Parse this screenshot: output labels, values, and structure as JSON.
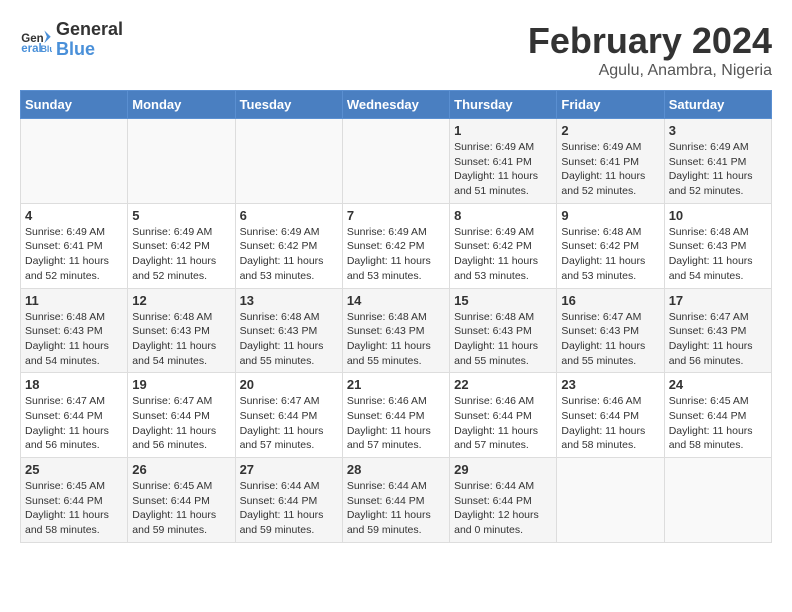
{
  "logo": {
    "text_general": "General",
    "text_blue": "Blue"
  },
  "title": "February 2024",
  "subtitle": "Agulu, Anambra, Nigeria",
  "days_of_week": [
    "Sunday",
    "Monday",
    "Tuesday",
    "Wednesday",
    "Thursday",
    "Friday",
    "Saturday"
  ],
  "weeks": [
    [
      {
        "day": "",
        "info": ""
      },
      {
        "day": "",
        "info": ""
      },
      {
        "day": "",
        "info": ""
      },
      {
        "day": "",
        "info": ""
      },
      {
        "day": "1",
        "info": "Sunrise: 6:49 AM\nSunset: 6:41 PM\nDaylight: 11 hours\nand 51 minutes."
      },
      {
        "day": "2",
        "info": "Sunrise: 6:49 AM\nSunset: 6:41 PM\nDaylight: 11 hours\nand 52 minutes."
      },
      {
        "day": "3",
        "info": "Sunrise: 6:49 AM\nSunset: 6:41 PM\nDaylight: 11 hours\nand 52 minutes."
      }
    ],
    [
      {
        "day": "4",
        "info": "Sunrise: 6:49 AM\nSunset: 6:41 PM\nDaylight: 11 hours\nand 52 minutes."
      },
      {
        "day": "5",
        "info": "Sunrise: 6:49 AM\nSunset: 6:42 PM\nDaylight: 11 hours\nand 52 minutes."
      },
      {
        "day": "6",
        "info": "Sunrise: 6:49 AM\nSunset: 6:42 PM\nDaylight: 11 hours\nand 53 minutes."
      },
      {
        "day": "7",
        "info": "Sunrise: 6:49 AM\nSunset: 6:42 PM\nDaylight: 11 hours\nand 53 minutes."
      },
      {
        "day": "8",
        "info": "Sunrise: 6:49 AM\nSunset: 6:42 PM\nDaylight: 11 hours\nand 53 minutes."
      },
      {
        "day": "9",
        "info": "Sunrise: 6:48 AM\nSunset: 6:42 PM\nDaylight: 11 hours\nand 53 minutes."
      },
      {
        "day": "10",
        "info": "Sunrise: 6:48 AM\nSunset: 6:43 PM\nDaylight: 11 hours\nand 54 minutes."
      }
    ],
    [
      {
        "day": "11",
        "info": "Sunrise: 6:48 AM\nSunset: 6:43 PM\nDaylight: 11 hours\nand 54 minutes."
      },
      {
        "day": "12",
        "info": "Sunrise: 6:48 AM\nSunset: 6:43 PM\nDaylight: 11 hours\nand 54 minutes."
      },
      {
        "day": "13",
        "info": "Sunrise: 6:48 AM\nSunset: 6:43 PM\nDaylight: 11 hours\nand 55 minutes."
      },
      {
        "day": "14",
        "info": "Sunrise: 6:48 AM\nSunset: 6:43 PM\nDaylight: 11 hours\nand 55 minutes."
      },
      {
        "day": "15",
        "info": "Sunrise: 6:48 AM\nSunset: 6:43 PM\nDaylight: 11 hours\nand 55 minutes."
      },
      {
        "day": "16",
        "info": "Sunrise: 6:47 AM\nSunset: 6:43 PM\nDaylight: 11 hours\nand 55 minutes."
      },
      {
        "day": "17",
        "info": "Sunrise: 6:47 AM\nSunset: 6:43 PM\nDaylight: 11 hours\nand 56 minutes."
      }
    ],
    [
      {
        "day": "18",
        "info": "Sunrise: 6:47 AM\nSunset: 6:44 PM\nDaylight: 11 hours\nand 56 minutes."
      },
      {
        "day": "19",
        "info": "Sunrise: 6:47 AM\nSunset: 6:44 PM\nDaylight: 11 hours\nand 56 minutes."
      },
      {
        "day": "20",
        "info": "Sunrise: 6:47 AM\nSunset: 6:44 PM\nDaylight: 11 hours\nand 57 minutes."
      },
      {
        "day": "21",
        "info": "Sunrise: 6:46 AM\nSunset: 6:44 PM\nDaylight: 11 hours\nand 57 minutes."
      },
      {
        "day": "22",
        "info": "Sunrise: 6:46 AM\nSunset: 6:44 PM\nDaylight: 11 hours\nand 57 minutes."
      },
      {
        "day": "23",
        "info": "Sunrise: 6:46 AM\nSunset: 6:44 PM\nDaylight: 11 hours\nand 58 minutes."
      },
      {
        "day": "24",
        "info": "Sunrise: 6:45 AM\nSunset: 6:44 PM\nDaylight: 11 hours\nand 58 minutes."
      }
    ],
    [
      {
        "day": "25",
        "info": "Sunrise: 6:45 AM\nSunset: 6:44 PM\nDaylight: 11 hours\nand 58 minutes."
      },
      {
        "day": "26",
        "info": "Sunrise: 6:45 AM\nSunset: 6:44 PM\nDaylight: 11 hours\nand 59 minutes."
      },
      {
        "day": "27",
        "info": "Sunrise: 6:44 AM\nSunset: 6:44 PM\nDaylight: 11 hours\nand 59 minutes."
      },
      {
        "day": "28",
        "info": "Sunrise: 6:44 AM\nSunset: 6:44 PM\nDaylight: 11 hours\nand 59 minutes."
      },
      {
        "day": "29",
        "info": "Sunrise: 6:44 AM\nSunset: 6:44 PM\nDaylight: 12 hours\nand 0 minutes."
      },
      {
        "day": "",
        "info": ""
      },
      {
        "day": "",
        "info": ""
      }
    ]
  ]
}
